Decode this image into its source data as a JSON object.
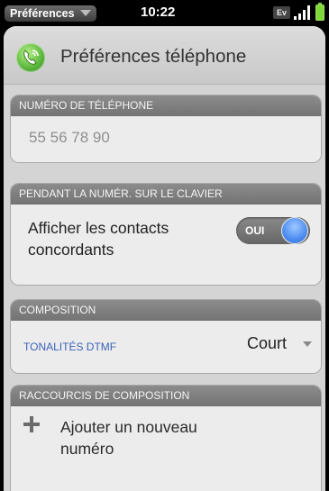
{
  "statusbar": {
    "app_menu": "Préférences",
    "time": "10:22",
    "network": "Ev"
  },
  "header": {
    "title": "Préférences téléphone",
    "icon": "phone-icon"
  },
  "phone_number_section": {
    "title": "NUMÉRO DE TÉLÉPHONE",
    "value": "55 56 78 90"
  },
  "dialing_section": {
    "title": "PENDANT LA NUMÉR. SUR LE CLAVIER",
    "contacts_label": "Afficher les contacts concordants",
    "toggle_value": "OUI",
    "toggle_on": true
  },
  "composition_section": {
    "title": "COMPOSITION",
    "dtmf_label": "TONALITÉS DTMF",
    "dtmf_value": "Court"
  },
  "shortcuts_section": {
    "title": "RACCOURCIS DE COMPOSITION",
    "add_label": "Ajouter un nouveau numéro"
  },
  "colors": {
    "accent_blue": "#3b63b8",
    "toggle_knob": "#4d8df0",
    "battery": "#7ed63a"
  }
}
